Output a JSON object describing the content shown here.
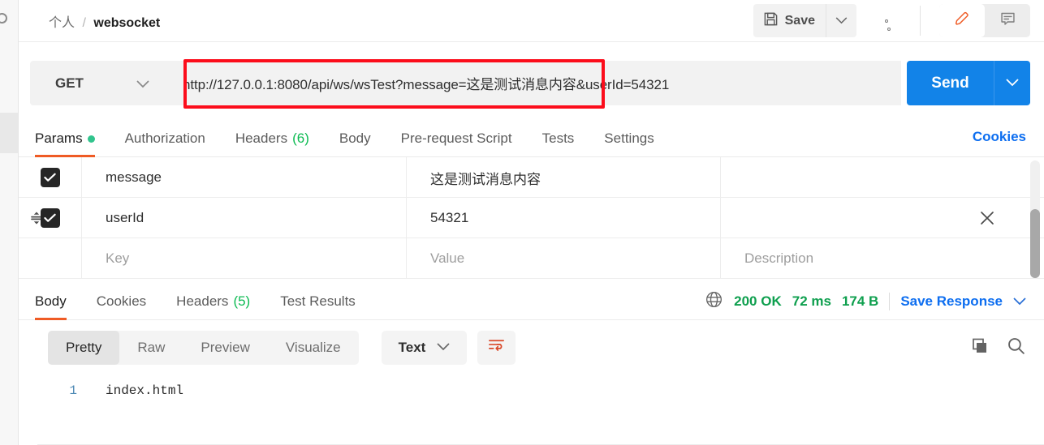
{
  "rail": {
    "icon": "circle-icon"
  },
  "header": {
    "breadcrumb_root": "个人",
    "breadcrumb_sep": "/",
    "breadcrumb_leaf": "websocket",
    "save_label": "Save",
    "save_icon": "floppy-disk-icon",
    "save_caret_icon": "chevron-down-icon",
    "more_icon": "ellipsis-icon",
    "edit_icon": "pencil-icon",
    "comment_icon": "comment-icon",
    "accent_orange": "#ef5b25"
  },
  "request": {
    "method": "GET",
    "method_caret_icon": "chevron-down-icon",
    "url": "http://127.0.0.1:8080/api/ws/wsTest?message=这是测试消息内容&userId=54321",
    "highlight_color": "#fc0d1b",
    "send_label": "Send",
    "send_caret_icon": "chevron-down-icon",
    "send_color": "#1283e8"
  },
  "request_tabs": {
    "items": [
      {
        "label": "Params",
        "active": true,
        "dot": true
      },
      {
        "label": "Authorization",
        "active": false
      },
      {
        "label": "Headers",
        "count": "(6)",
        "active": false
      },
      {
        "label": "Body",
        "active": false
      },
      {
        "label": "Pre-request Script",
        "active": false
      },
      {
        "label": "Tests",
        "active": false
      },
      {
        "label": "Settings",
        "active": false
      }
    ],
    "cookies_link": "Cookies"
  },
  "params_table": {
    "rows": [
      {
        "checked": true,
        "key": "message",
        "value": "这是测试消息内容",
        "description": ""
      },
      {
        "checked": true,
        "key": "userId",
        "value": "54321",
        "description": "",
        "hovered": true
      }
    ],
    "placeholder_row": {
      "key_placeholder": "Key",
      "value_placeholder": "Value",
      "description_placeholder": "Description"
    },
    "delete_icon": "close-icon",
    "drag_icon": "drag-handle-icon"
  },
  "response_tabs": {
    "items": [
      {
        "label": "Body",
        "active": true
      },
      {
        "label": "Cookies",
        "active": false
      },
      {
        "label": "Headers",
        "count": "(5)",
        "active": false
      },
      {
        "label": "Test Results",
        "active": false
      }
    ],
    "globe_icon": "globe-icon",
    "status": "200 OK",
    "time": "72 ms",
    "size": "174 B",
    "save_response": "Save Response",
    "save_response_caret": "chevron-down-icon",
    "status_color": "#0e9f4e"
  },
  "format_bar": {
    "views": [
      {
        "label": "Pretty",
        "active": true
      },
      {
        "label": "Raw",
        "active": false
      },
      {
        "label": "Preview",
        "active": false
      },
      {
        "label": "Visualize",
        "active": false
      }
    ],
    "language": "Text",
    "language_caret_icon": "chevron-down-icon",
    "wrap_icon": "word-wrap-icon",
    "copy_icon": "copy-icon",
    "search_icon": "search-icon"
  },
  "response_body": {
    "lines": [
      {
        "number": "1",
        "content": "index.html"
      }
    ]
  }
}
